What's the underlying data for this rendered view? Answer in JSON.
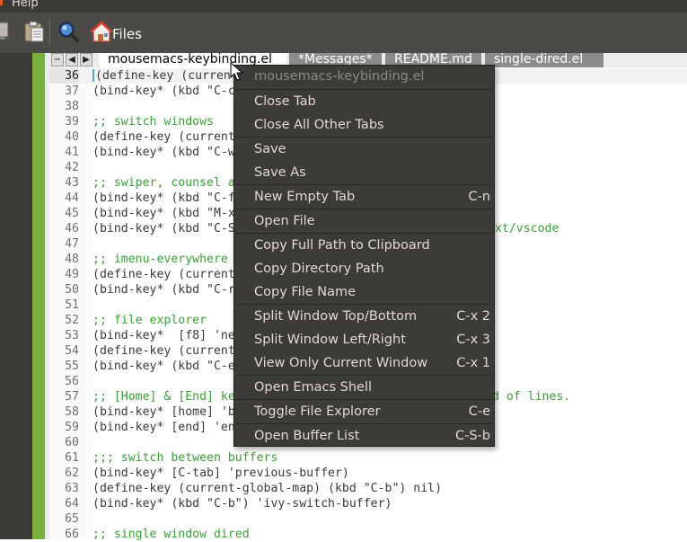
{
  "menubar": {
    "help_label": "Help"
  },
  "toolbar": {
    "files_label": "Files"
  },
  "tabs": {
    "items": [
      {
        "label": "mousemacs-keybinding.el"
      },
      {
        "label": "*Messages*"
      },
      {
        "label": "README.md"
      },
      {
        "label": "single-dired.el"
      }
    ],
    "collapse_symbol": "−",
    "prev_symbol": "◀",
    "next_symbol": "▶"
  },
  "code": {
    "lines": [
      {
        "num": "36",
        "text": "(define-key (current"
      },
      {
        "num": "37",
        "text": "(bind-key* (kbd \"C-c"
      },
      {
        "num": "38",
        "text": ""
      },
      {
        "num": "39",
        "text": ";; switch windows"
      },
      {
        "num": "40",
        "text": "(define-key (current"
      },
      {
        "num": "41",
        "text": "(bind-key* (kbd \"C-w"
      },
      {
        "num": "42",
        "text": ""
      },
      {
        "num": "43",
        "text": ";; swiper, counsel a"
      },
      {
        "num": "44",
        "text": "(bind-key* (kbd \"C-f"
      },
      {
        "num": "45",
        "text": "(bind-key* (kbd \"M-x"
      },
      {
        "num": "46",
        "text": "(bind-key* (kbd \"C-S",
        "tail": "ext/vscode"
      },
      {
        "num": "47",
        "text": ""
      },
      {
        "num": "48",
        "text": ";; imenu-everywhere"
      },
      {
        "num": "49",
        "text": "(define-key (current"
      },
      {
        "num": "50",
        "text": "(bind-key* (kbd \"C-r"
      },
      {
        "num": "51",
        "text": ""
      },
      {
        "num": "52",
        "text": ";; file explorer"
      },
      {
        "num": "53",
        "text": "(bind-key*  [f8] 'ne"
      },
      {
        "num": "54",
        "text": "(define-key (current"
      },
      {
        "num": "55",
        "text": "(bind-key* (kbd \"C-e"
      },
      {
        "num": "56",
        "text": ""
      },
      {
        "num": "57",
        "text": ";; [Home] & [End] ke",
        "tail": "nd of lines."
      },
      {
        "num": "58",
        "text": "(bind-key* [home] 'b"
      },
      {
        "num": "59",
        "text": "(bind-key* [end] 'en"
      },
      {
        "num": "60",
        "text": ""
      },
      {
        "num": "61",
        "text": ";;; switch between buffers"
      },
      {
        "num": "62",
        "text": "(bind-key* [C-tab] 'previous-buffer)"
      },
      {
        "num": "63",
        "text": "(define-key (current-global-map) (kbd \"C-b\") nil)"
      },
      {
        "num": "64",
        "text": "(bind-key* (kbd \"C-b\") 'ivy-switch-buffer)"
      },
      {
        "num": "65",
        "text": ""
      },
      {
        "num": "66",
        "text": ";; single window dired"
      }
    ]
  },
  "context_menu": {
    "header": "mousemacs-keybinding.el",
    "groups": [
      [
        {
          "label": "Close Tab",
          "shortcut": ""
        },
        {
          "label": "Close All Other Tabs",
          "shortcut": ""
        }
      ],
      [
        {
          "label": "Save",
          "shortcut": ""
        },
        {
          "label": "Save As",
          "shortcut": ""
        }
      ],
      [
        {
          "label": "New Empty Tab",
          "shortcut": "C-n"
        }
      ],
      [
        {
          "label": "Open File",
          "shortcut": ""
        }
      ],
      [
        {
          "label": "Copy Full Path to Clipboard",
          "shortcut": ""
        },
        {
          "label": "Copy Directory Path",
          "shortcut": ""
        },
        {
          "label": "Copy File Name",
          "shortcut": ""
        }
      ],
      [
        {
          "label": "Split Window Top/Bottom",
          "shortcut": "C-x 2"
        },
        {
          "label": "Split Window Left/Right",
          "shortcut": "C-x 3"
        },
        {
          "label": "View Only Current Window",
          "shortcut": "C-x 1"
        }
      ],
      [
        {
          "label": "Open Emacs Shell",
          "shortcut": ""
        }
      ],
      [
        {
          "label": "Toggle File Explorer",
          "shortcut": "C-e"
        }
      ],
      [
        {
          "label": "Open Buffer List",
          "shortcut": "C-S-b"
        }
      ]
    ]
  },
  "icons": {
    "toolbar": [
      "copy-icon",
      "paste-icon",
      "search-icon",
      "home-icon"
    ]
  }
}
